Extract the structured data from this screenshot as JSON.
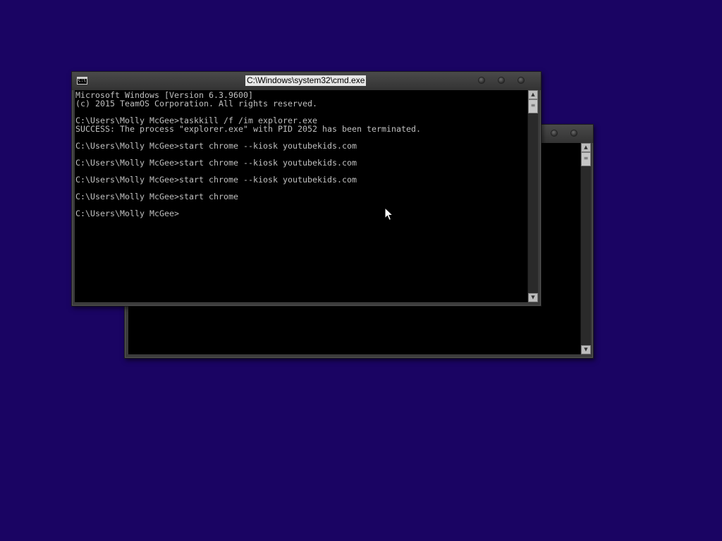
{
  "desktop": {
    "background_color": "#1a0463"
  },
  "back_window": {
    "title": "",
    "icon": "console-window-icon"
  },
  "front_window": {
    "title": "C:\\Windows\\system32\\cmd.exe",
    "icon": "console-window-icon",
    "controls": [
      "minimize-button",
      "maximize-button",
      "close-button"
    ],
    "console_lines": [
      "Microsoft Windows [Version 6.3.9600]",
      "(c) 2015 TeamOS Corporation. All rights reserved.",
      "",
      "C:\\Users\\Molly McGee>taskkill /f /im explorer.exe",
      "SUCCESS: The process \"explorer.exe\" with PID 2052 has been terminated.",
      "",
      "C:\\Users\\Molly McGee>start chrome --kiosk youtubekids.com",
      "",
      "C:\\Users\\Molly McGee>start chrome --kiosk youtubekids.com",
      "",
      "C:\\Users\\Molly McGee>start chrome --kiosk youtubekids.com",
      "",
      "C:\\Users\\Molly McGee>start chrome",
      "",
      "C:\\Users\\Molly McGee>"
    ],
    "text_color": "#c0c0c0",
    "console_background": "#000000"
  },
  "cursor": {
    "icon": "arrow-cursor-icon"
  }
}
